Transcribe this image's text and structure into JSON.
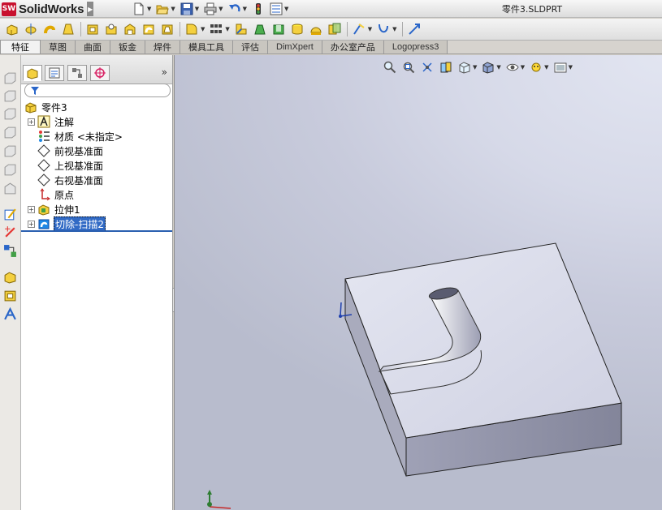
{
  "app": {
    "name": "SolidWorks",
    "logo_text": "SW"
  },
  "document": {
    "title": "零件3.SLDPRT"
  },
  "quick_access": [
    {
      "icon": "new-document-icon"
    },
    {
      "icon": "open-folder-icon"
    },
    {
      "icon": "save-icon"
    },
    {
      "icon": "print-icon"
    },
    {
      "icon": "undo-icon"
    },
    {
      "icon": "rebuild-icon"
    },
    {
      "icon": "options-icon"
    }
  ],
  "command_manager": {
    "tools": [
      "extruded-boss-icon",
      "revolved-boss-icon",
      "swept-boss-icon",
      "lofted-boss-icon",
      "extruded-cut-icon",
      "hole-wizard-icon",
      "revolved-cut-icon",
      "swept-cut-icon",
      "lofted-cut-icon",
      "fillet-icon",
      "linear-pattern-icon",
      "rib-icon",
      "draft-icon",
      "shell-icon",
      "wrap-icon",
      "dome-icon",
      "intersect-icon",
      "reference-geometry-icon",
      "curves-icon",
      "instant3d-icon"
    ]
  },
  "tabs": [
    {
      "label": "特征",
      "active": true
    },
    {
      "label": "草图"
    },
    {
      "label": "曲面"
    },
    {
      "label": "钣金"
    },
    {
      "label": "焊件"
    },
    {
      "label": "模具工具"
    },
    {
      "label": "评估"
    },
    {
      "label": "DimXpert"
    },
    {
      "label": "办公室产品"
    },
    {
      "label": "Logopress3"
    }
  ],
  "feature_manager": {
    "tabs": [
      "featuremanager-tree-icon",
      "property-manager-icon",
      "configuration-manager-icon",
      "dimxpert-manager-icon"
    ],
    "more": "»",
    "root": "零件3",
    "items": [
      {
        "label": "注解",
        "icon": "annotations-icon",
        "expandable": true
      },
      {
        "label": "材质 <未指定>",
        "icon": "material-icon",
        "expandable": false
      },
      {
        "label": "前视基准面",
        "icon": "plane-icon",
        "expandable": false
      },
      {
        "label": "上视基准面",
        "icon": "plane-icon",
        "expandable": false
      },
      {
        "label": "右视基准面",
        "icon": "plane-icon",
        "expandable": false
      },
      {
        "label": "原点",
        "icon": "origin-icon",
        "expandable": false
      },
      {
        "label": "拉伸1",
        "icon": "extrude-feature-icon",
        "expandable": true
      },
      {
        "label": "切除-扫描2",
        "icon": "swept-cut-feature-icon",
        "expandable": true,
        "selected": true
      }
    ]
  },
  "heads_up_toolbar": [
    "zoom-to-fit-icon",
    "zoom-to-area-icon",
    "previous-view-icon",
    "section-view-icon",
    "view-orientation-icon",
    "display-style-icon",
    "hide-show-items-icon",
    "edit-appearance-icon",
    "apply-scene-icon"
  ],
  "colors": {
    "selection": "#316ac5",
    "model_top": "#d9dbe9",
    "model_front": "#8f91a6",
    "model_right": "#a9abbd",
    "logo_red": "#c8102e"
  }
}
